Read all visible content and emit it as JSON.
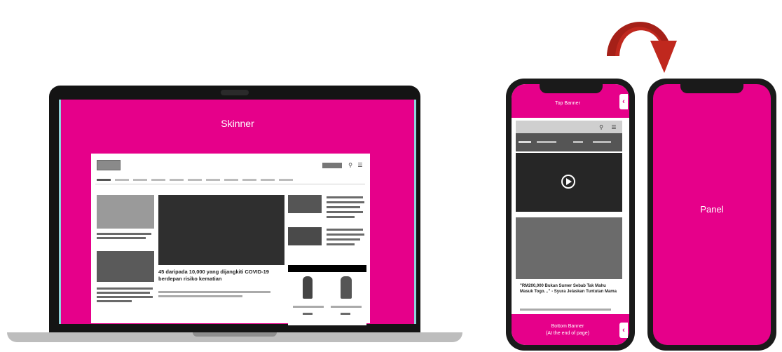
{
  "laptop": {
    "skinner_label": "Skinner",
    "site": {
      "headline": "45 daripada 10,000 yang dijangkiti COVID-19 berdepan risiko kematian"
    }
  },
  "phone_left": {
    "top_banner_label": "Top Banner",
    "bottom_banner_label_line1": "Bottom Banner",
    "bottom_banner_label_line2": "(At the end of page)",
    "article_headline": "\"RM200,000 Bukan Sumer Sebab Tak Mahu Masuk Togo…\" - Syura Jelaskan Tuntutan Mama",
    "chevron": "‹"
  },
  "phone_right": {
    "panel_label": "Panel"
  },
  "colors": {
    "skin_pink": "#e6008a",
    "arrow_red": "#c0281e",
    "accent_cyan": "#8fd3dc"
  },
  "icons": [
    "curved-arrow-icon",
    "play-icon",
    "search-icon",
    "menu-icon"
  ]
}
